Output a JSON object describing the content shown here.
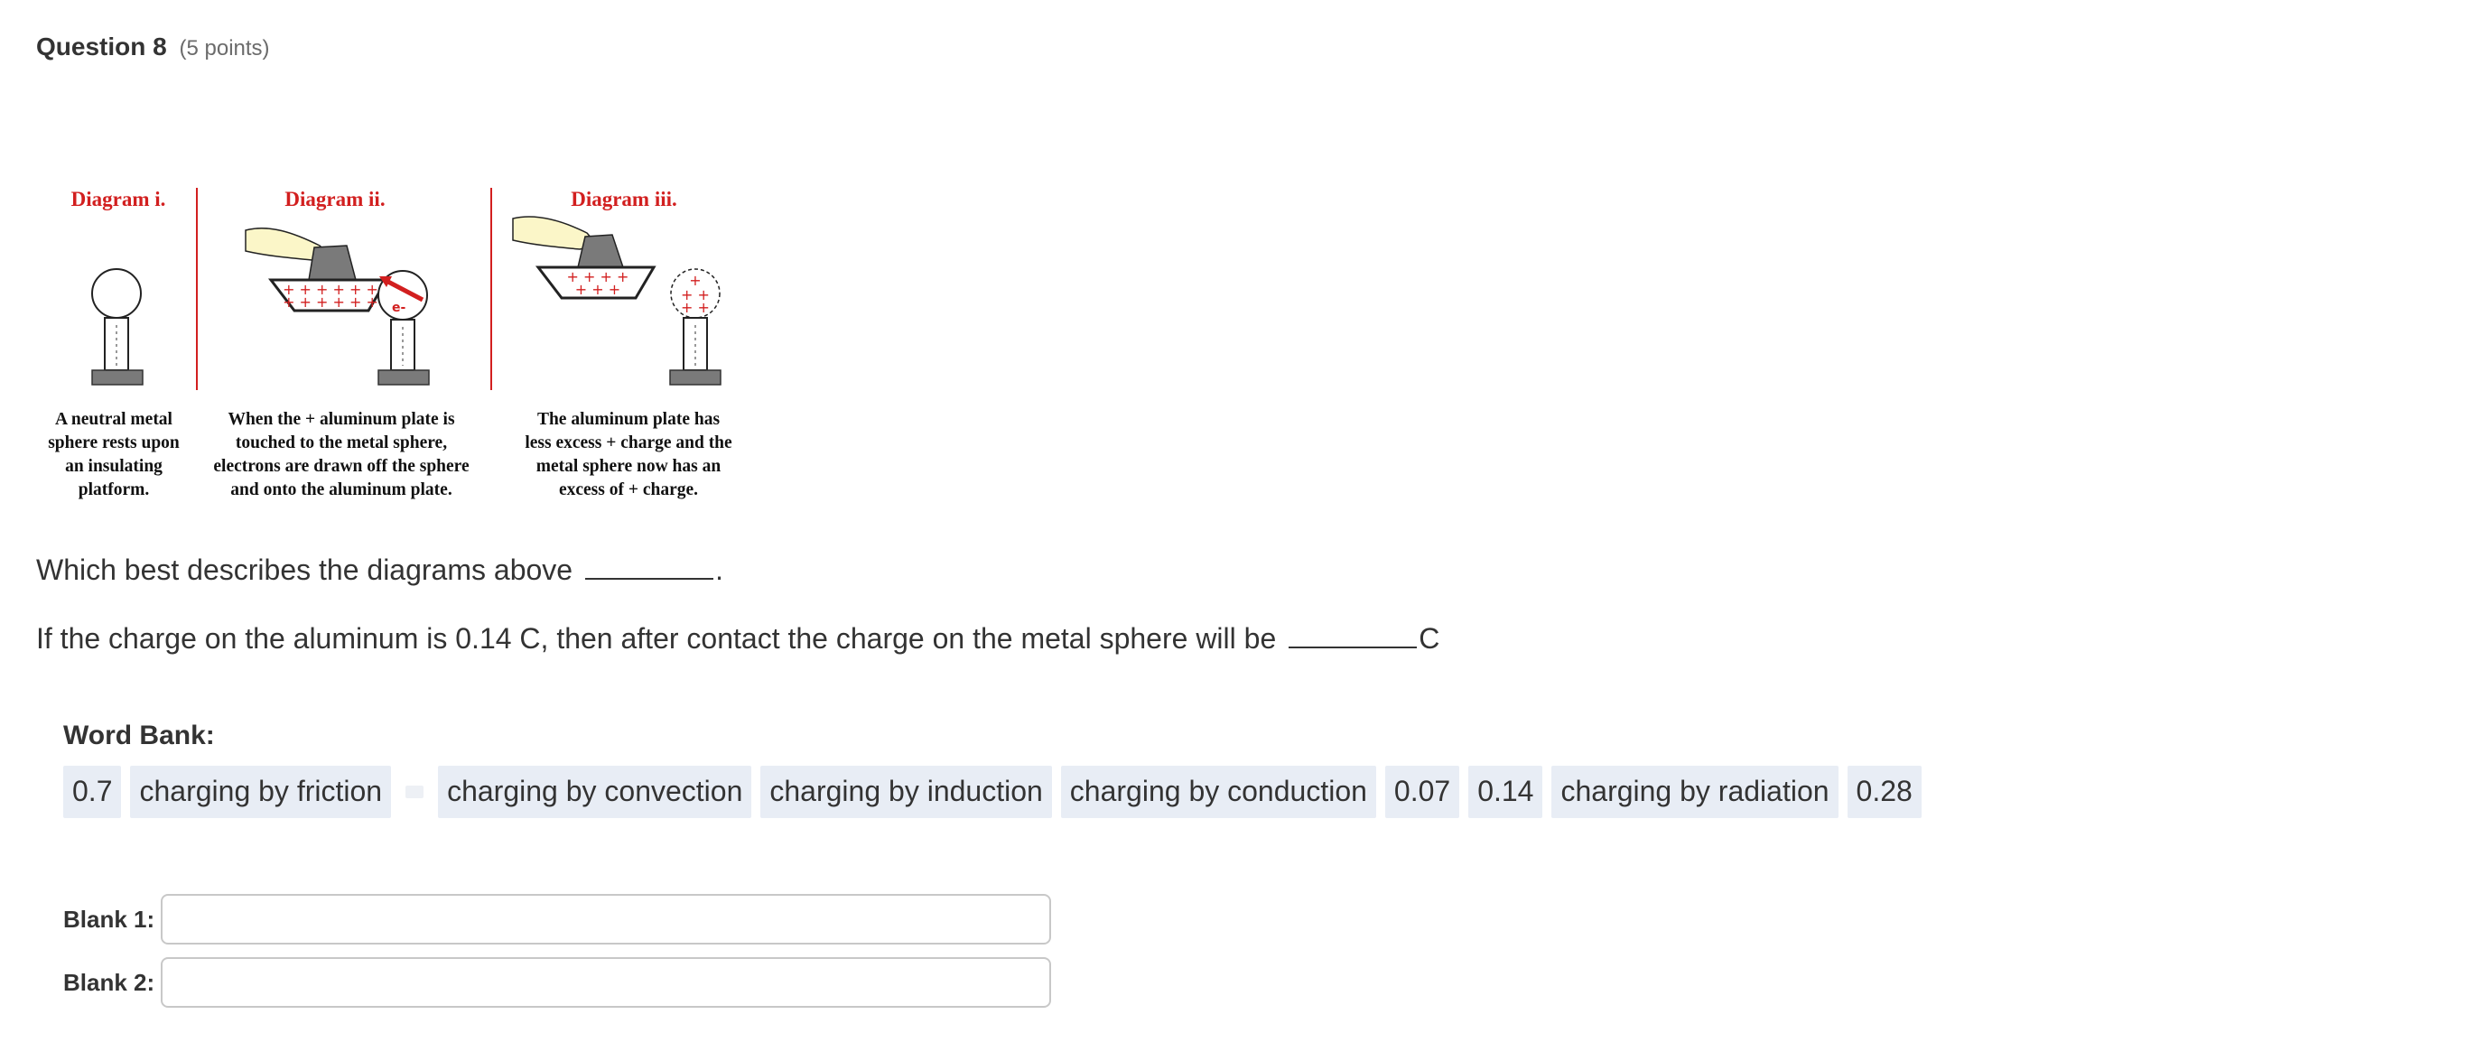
{
  "question": {
    "title": "Question 8",
    "points": "(5 points)"
  },
  "diagrams": {
    "labels": [
      "Diagram i.",
      "Diagram ii.",
      "Diagram iii."
    ],
    "electron_label": "e-",
    "captions": [
      [
        "A neutral metal",
        "sphere rests upon",
        "an insulating",
        "platform."
      ],
      [
        "When the + aluminum plate is",
        "touched to the metal sphere,",
        "electrons are drawn off the sphere",
        "and onto the aluminum plate."
      ],
      [
        "The aluminum plate has",
        "less excess + charge and the",
        "metal sphere now has an",
        "excess of + charge."
      ]
    ],
    "colors": {
      "accent_red": "#d21f1f",
      "platform_gray": "#7a7a7a",
      "hand": "#fbf6c8"
    }
  },
  "prompts": {
    "line1_text": "Which best describes the diagrams above",
    "line1_after": ".",
    "line2_text": "If the charge on the aluminum is 0.14 C, then after contact the charge on the metal sphere will be",
    "line2_after": "C"
  },
  "word_bank": {
    "title": "Word Bank:",
    "items": [
      "0.7",
      "charging by friction",
      "charging by convection",
      "charging by induction",
      "charging by conduction",
      "0.07",
      "0.14",
      "charging by radiation",
      "0.28"
    ]
  },
  "blanks": {
    "blank1_label": "Blank 1:",
    "blank1_value": "",
    "blank2_label": "Blank 2:",
    "blank2_value": ""
  }
}
